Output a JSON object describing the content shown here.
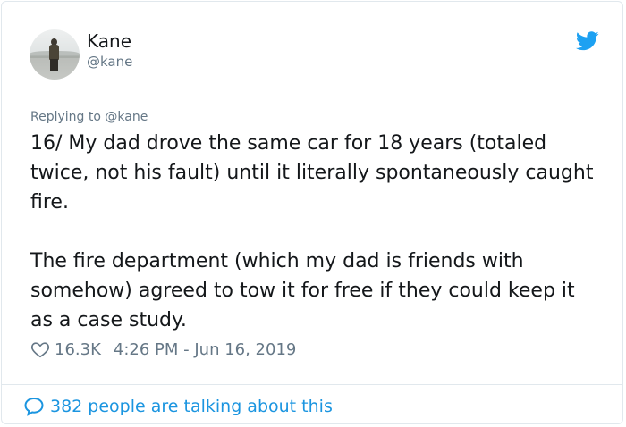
{
  "author": {
    "name": "Kane",
    "handle": "@kane"
  },
  "reply_to": "Replying to @kane",
  "tweet": {
    "text": "16/ My dad drove the same car for 18 years (totaled twice, not his fault) until it literally spontaneously caught fire.\n\nThe fire department (which my dad is friends with somehow) agreed to tow it for free if they could keep it as a case study.",
    "likes": "16.3K",
    "timestamp": "4:26 PM - Jun 16, 2019"
  },
  "footer": {
    "conversation": "382 people are talking about this"
  },
  "icons": {
    "brand": "twitter-bird-icon",
    "like": "heart-icon",
    "reply": "speech-bubble-icon"
  },
  "colors": {
    "brand_blue": "#1da1f2",
    "link_blue": "#1b95e0",
    "secondary_text": "#657786",
    "primary_text": "#14171a",
    "border": "#e1e8ed"
  }
}
